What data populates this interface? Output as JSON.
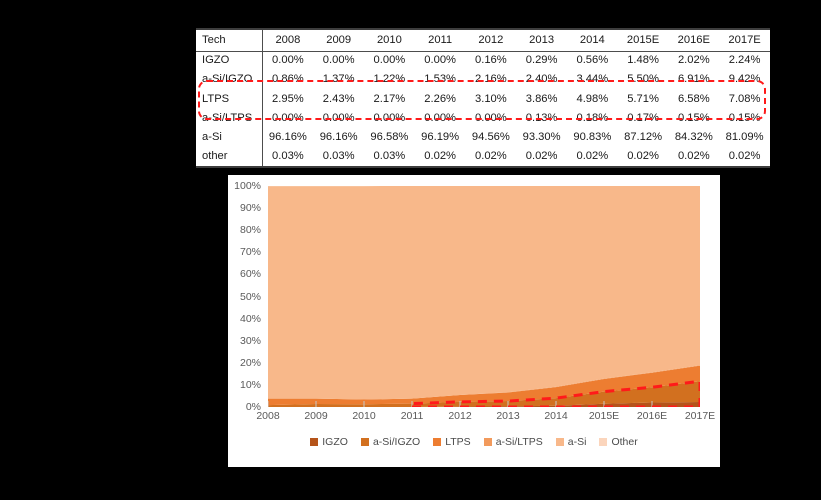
{
  "table": {
    "columns": [
      "Tech",
      "2008",
      "2009",
      "2010",
      "2011",
      "2012",
      "2013",
      "2014",
      "2015E",
      "2016E",
      "2017E"
    ],
    "rows": [
      {
        "label": "IGZO",
        "values": [
          "0.00%",
          "0.00%",
          "0.00%",
          "0.00%",
          "0.16%",
          "0.29%",
          "0.56%",
          "1.48%",
          "2.02%",
          "2.24%"
        ]
      },
      {
        "label": "a-Si/IGZO",
        "values": [
          "0.86%",
          "1.37%",
          "1.22%",
          "1.53%",
          "2.16%",
          "2.40%",
          "3.44%",
          "5.50%",
          "6.91%",
          "9.42%"
        ]
      },
      {
        "label": "LTPS",
        "values": [
          "2.95%",
          "2.43%",
          "2.17%",
          "2.26%",
          "3.10%",
          "3.86%",
          "4.98%",
          "5.71%",
          "6.58%",
          "7.08%"
        ]
      },
      {
        "label": "a-Si/LTPS",
        "values": [
          "0.00%",
          "0.00%",
          "0.00%",
          "0.00%",
          "0.00%",
          "0.13%",
          "0.18%",
          "0.17%",
          "0.15%",
          "0.15%"
        ]
      },
      {
        "label": "a-Si",
        "values": [
          "96.16%",
          "96.16%",
          "96.58%",
          "96.19%",
          "94.56%",
          "93.30%",
          "90.83%",
          "87.12%",
          "84.32%",
          "81.09%"
        ]
      },
      {
        "label": "other",
        "values": [
          "0.03%",
          "0.03%",
          "0.03%",
          "0.02%",
          "0.02%",
          "0.02%",
          "0.02%",
          "0.02%",
          "0.02%",
          "0.02%"
        ]
      }
    ],
    "highlight_color": "#ff1a1a"
  },
  "chart_data": {
    "type": "area",
    "title": "",
    "xlabel": "",
    "ylabel": "",
    "stacked": true,
    "stack_normalized": true,
    "grid": false,
    "legend_position": "bottom",
    "ylim": [
      0,
      100
    ],
    "categories": [
      "2008",
      "2009",
      "2010",
      "2011",
      "2012",
      "2013",
      "2014",
      "2015E",
      "2016E",
      "2017E"
    ],
    "y_ticks": [
      "0%",
      "10%",
      "20%",
      "30%",
      "40%",
      "50%",
      "60%",
      "70%",
      "80%",
      "90%",
      "100%"
    ],
    "series": [
      {
        "name": "IGZO",
        "color": "#b5541a",
        "values": [
          0.0,
          0.0,
          0.0,
          0.0,
          0.16,
          0.29,
          0.56,
          1.48,
          2.02,
          2.24
        ]
      },
      {
        "name": "a-Si/IGZO",
        "color": "#d2701f",
        "values": [
          0.86,
          1.37,
          1.22,
          1.53,
          2.16,
          2.4,
          3.44,
          5.5,
          6.91,
          9.42
        ]
      },
      {
        "name": "LTPS",
        "color": "#ed7d31",
        "values": [
          2.95,
          2.43,
          2.17,
          2.26,
          3.1,
          3.86,
          4.98,
          5.71,
          6.58,
          7.08
        ]
      },
      {
        "name": "a-Si/LTPS",
        "color": "#f29a5c",
        "values": [
          0.0,
          0.0,
          0.0,
          0.0,
          0.0,
          0.13,
          0.18,
          0.17,
          0.15,
          0.15
        ]
      },
      {
        "name": "a-Si",
        "color": "#f8b88a",
        "values": [
          96.16,
          96.16,
          96.58,
          96.19,
          94.56,
          93.3,
          90.83,
          87.12,
          84.32,
          81.09
        ]
      },
      {
        "name": "Other",
        "color": "#fbd5bc",
        "values": [
          0.03,
          0.03,
          0.03,
          0.02,
          0.02,
          0.02,
          0.02,
          0.02,
          0.02,
          0.02
        ]
      }
    ],
    "annotation": {
      "type": "dashed-region",
      "color": "#ff1a1a",
      "covers_series": [
        "IGZO",
        "a-Si/IGZO"
      ],
      "from_category": "2011",
      "to_category": "2017E"
    }
  }
}
